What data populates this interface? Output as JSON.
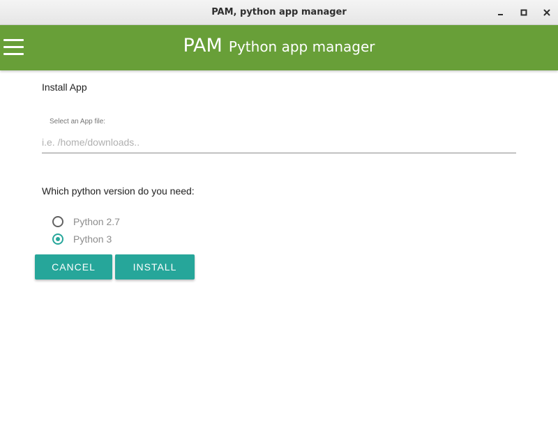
{
  "window": {
    "title": "PAM, python app manager",
    "controls": {
      "minimize_icon": "minimize-icon",
      "maximize_icon": "maximize-icon",
      "close_icon": "close-icon"
    }
  },
  "appbar": {
    "menu_icon": "hamburger-menu-icon",
    "title_main": "PAM",
    "title_sub": "Python app manager",
    "color": "#689f38"
  },
  "install": {
    "section_title": "Install App",
    "file_label": "Select an App file:",
    "file_value": "",
    "file_placeholder": "i.e. /home/downloads..",
    "version_question": "Which python version do you need:",
    "options": [
      {
        "label": "Python 2.7",
        "selected": false
      },
      {
        "label": "Python 3",
        "selected": true
      }
    ]
  },
  "actions": {
    "cancel_label": "CANCEL",
    "install_label": "INSTALL",
    "accent_color": "#26a69a"
  }
}
